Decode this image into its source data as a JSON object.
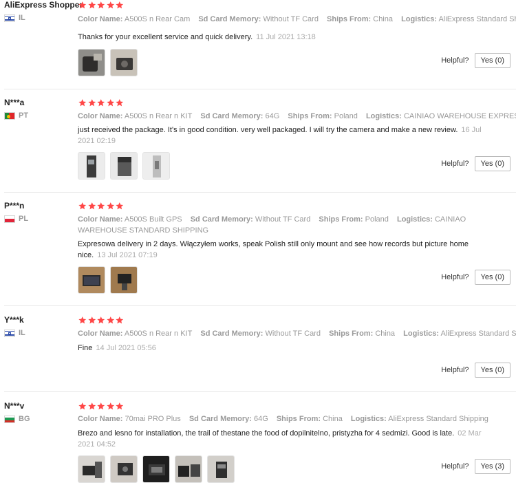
{
  "colors": {
    "star": "#ff4747",
    "muted": "#999999",
    "text": "#222222",
    "border": "#e8e8e8"
  },
  "icons": {
    "star": "star-icon",
    "flag": "country-flag-icon"
  },
  "reviews": [
    {
      "user": "AliExpress Shopper",
      "country_code": "IL",
      "flag": "il",
      "rating": 5,
      "attributes": [
        {
          "k": "Color Name:",
          "v": "A500S n Rear Cam"
        },
        {
          "k": "Sd Card Memory:",
          "v": "Without TF Card"
        },
        {
          "k": "Ships From:",
          "v": "China"
        },
        {
          "k": "Logistics:",
          "v": "AliExpress Standard Shipping"
        }
      ],
      "text": "Thanks for your excellent service and quick delivery.",
      "date": "11 Jul 2021 13:18",
      "photos": 2,
      "helpful_label": "Helpful?",
      "yes_label": "Yes (0)"
    },
    {
      "user": "N***a",
      "country_code": "PT",
      "flag": "pt",
      "rating": 5,
      "attributes": [
        {
          "k": "Color Name:",
          "v": "A500S n Rear n KIT"
        },
        {
          "k": "Sd Card Memory:",
          "v": "64G"
        },
        {
          "k": "Ships From:",
          "v": "Poland"
        },
        {
          "k": "Logistics:",
          "v": "CAINIAO WAREHOUSE EXPRESS SHIPPING"
        }
      ],
      "text": "just received the package. It's in good condition. very well packaged. I will try the camera and make a new review.",
      "date": "16 Jul 2021 02:19",
      "photos": 3,
      "helpful_label": "Helpful?",
      "yes_label": "Yes (0)"
    },
    {
      "user": "P***n",
      "country_code": "PL",
      "flag": "pl",
      "rating": 5,
      "attributes": [
        {
          "k": "Color Name:",
          "v": "A500S Built GPS"
        },
        {
          "k": "Sd Card Memory:",
          "v": "Without TF Card"
        },
        {
          "k": "Ships From:",
          "v": "Poland"
        },
        {
          "k": "Logistics:",
          "v": "CAINIAO WAREHOUSE STANDARD SHIPPING"
        }
      ],
      "text": "Expresowa delivery in 2 days. Włączyłem works, speak Polish still only mount and see how records but picture home nice.",
      "date": "13 Jul 2021 07:19",
      "photos": 2,
      "helpful_label": "Helpful?",
      "yes_label": "Yes (0)"
    },
    {
      "user": "Y***k",
      "country_code": "IL",
      "flag": "il",
      "rating": 5,
      "attributes": [
        {
          "k": "Color Name:",
          "v": "A500S n Rear n KIT"
        },
        {
          "k": "Sd Card Memory:",
          "v": "Without TF Card"
        },
        {
          "k": "Ships From:",
          "v": "China"
        },
        {
          "k": "Logistics:",
          "v": "AliExpress Standard Shipping"
        }
      ],
      "text": "Fine",
      "date": "14 Jul 2021 05:56",
      "photos": 0,
      "helpful_label": "Helpful?",
      "yes_label": "Yes (0)"
    },
    {
      "user": "N***v",
      "country_code": "BG",
      "flag": "bg",
      "rating": 5,
      "attributes": [
        {
          "k": "Color Name:",
          "v": "70mai PRO Plus"
        },
        {
          "k": "Sd Card Memory:",
          "v": "64G"
        },
        {
          "k": "Ships From:",
          "v": "China"
        },
        {
          "k": "Logistics:",
          "v": "AliExpress Standard Shipping"
        }
      ],
      "text": "Brezo and lesno for installation, the trail of thestane the food of dopilnitelno, pristyzha for 4 sedmizi. Good is late.",
      "date": "02 Mar 2021 04:52",
      "photos": 5,
      "helpful_label": "Helpful?",
      "yes_label": "Yes (3)"
    }
  ]
}
